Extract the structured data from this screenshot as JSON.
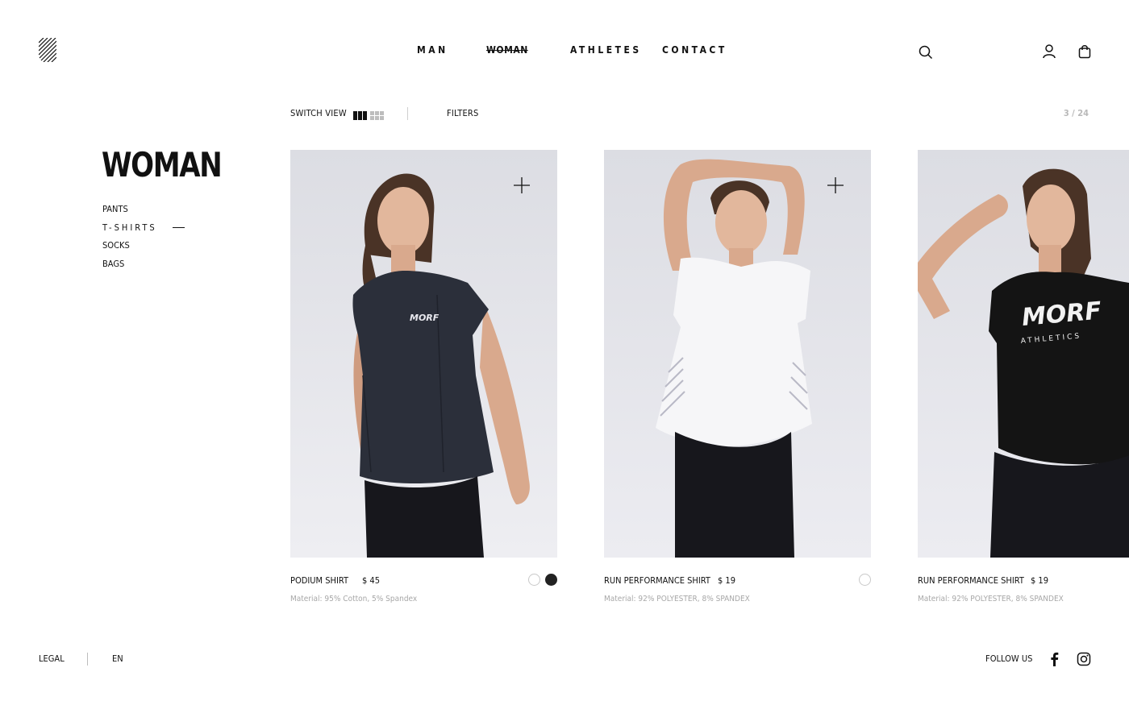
{
  "brand": {
    "logo_icon": "diagonal-stripes-logo-icon"
  },
  "nav": {
    "items": [
      {
        "label": "MAN",
        "active": false
      },
      {
        "label": "WOMAN",
        "active": true
      },
      {
        "label": "ATHLETES",
        "active": false
      },
      {
        "label": "CONTACT",
        "active": false
      }
    ]
  },
  "header_icons": {
    "search": "search-icon",
    "account": "user-icon",
    "cart": "shopping-bag-icon"
  },
  "toolbar": {
    "switch_view_label": "SWITCH VIEW",
    "view_modes": [
      "grid-3-icon",
      "grid-6-icon"
    ],
    "active_view": "grid-3-icon",
    "filters_label": "FILTERS",
    "pager": "3 / 24"
  },
  "page": {
    "title": "WOMAN",
    "categories": [
      {
        "label": "PANTS",
        "active": false
      },
      {
        "label": "T-SHIRTS",
        "active": true
      },
      {
        "label": "SOCKS",
        "active": false
      },
      {
        "label": "BAGS",
        "active": false
      }
    ]
  },
  "products": [
    {
      "name": "PODIUM SHIRT",
      "price": "$ 45",
      "material": "Material: 95% Cotton, 5% Spandex",
      "swatches": [
        "#ffffff",
        "#222222"
      ],
      "shirt_color": "#2b2f3a",
      "shirt_logo": "MORF"
    },
    {
      "name": "RUN PERFORMANCE SHIRT",
      "price": "$ 19",
      "material": "Material: 92% POLYESTER, 8% SPANDEX",
      "swatches": [
        "#ffffff"
      ],
      "shirt_color": "#f6f6f8",
      "shirt_logo": ""
    },
    {
      "name": "RUN PERFORMANCE SHIRT",
      "price": "$ 19",
      "material": "Material: 92% POLYESTER, 8% SPANDEX",
      "swatches": [],
      "shirt_color": "#141414",
      "shirt_logo": "MORF",
      "shirt_sublogo": "ATHLETICS"
    }
  ],
  "footer": {
    "legal": "LEGAL",
    "language": "EN",
    "follow_us": "FOLLOW US",
    "social": [
      "facebook-icon",
      "instagram-icon"
    ]
  },
  "colors": {
    "text": "#111111",
    "muted": "#a7a7a7",
    "photo_bg": "#e4e4e9"
  }
}
